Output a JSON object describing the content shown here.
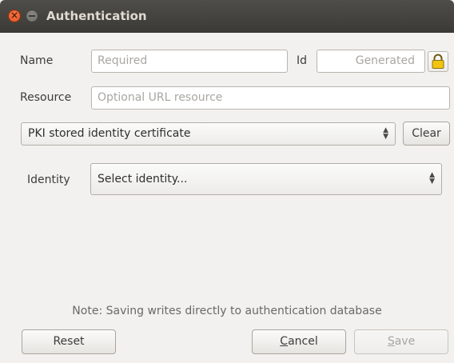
{
  "window": {
    "title": "Authentication"
  },
  "form": {
    "name_label": "Name",
    "name_placeholder": "Required",
    "id_label": "Id",
    "id_placeholder": "Generated",
    "resource_label": "Resource",
    "resource_placeholder": "Optional URL resource",
    "method_selected": "PKI stored identity certificate",
    "clear_label": "Clear",
    "identity_label": "Identity",
    "identity_selected": "Select identity..."
  },
  "note": "Note: Saving writes directly to authentication database",
  "buttons": {
    "reset": "Reset",
    "cancel_first": "C",
    "cancel_rest": "ancel",
    "save_first": "S",
    "save_rest": "ave"
  },
  "icons": {
    "close": "close-icon",
    "minimize": "minimize-icon",
    "lock": "lock-icon",
    "combo_arrows": "updown-arrows-icon"
  },
  "colors": {
    "titlebar": "#3f3e3a",
    "close": "#e95420",
    "lock": "#f2c40f"
  }
}
